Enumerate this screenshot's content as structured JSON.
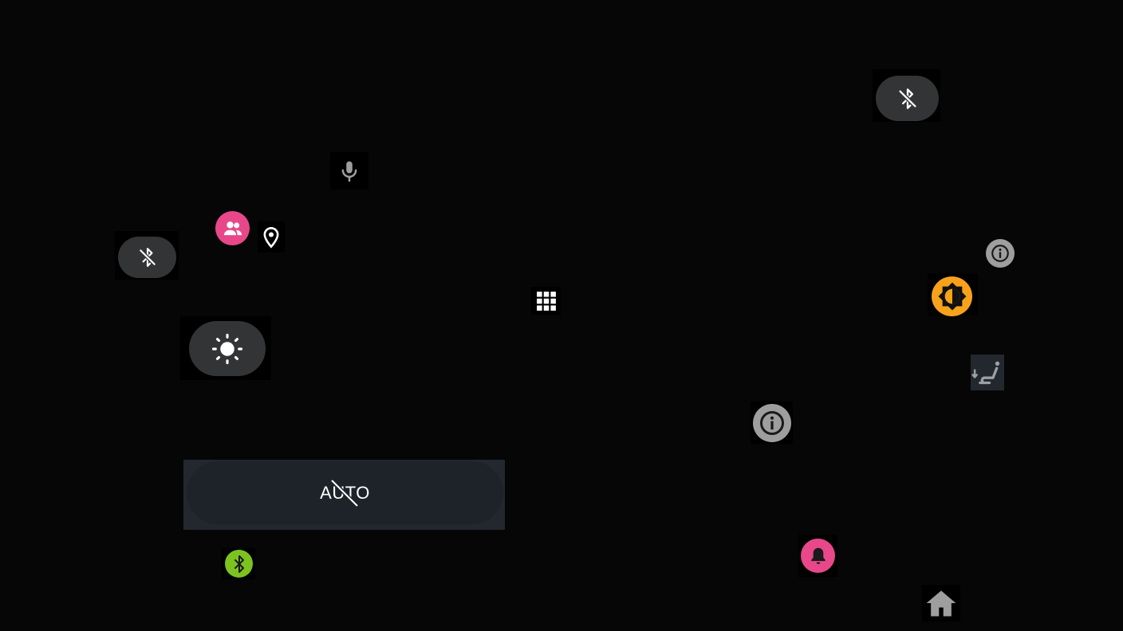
{
  "screen": {
    "background": "#060606",
    "tile_background": "#000000",
    "pill_background": "#323436",
    "auto_panel_background": "#22282e",
    "auto_pill_background": "#1d2329"
  },
  "controls": {
    "bluetooth_top": {
      "icon": "bluetooth-disabled-icon",
      "state": "off"
    },
    "bluetooth_left": {
      "icon": "bluetooth-disabled-icon",
      "state": "off"
    },
    "microphone": {
      "icon": "microphone-icon",
      "color": "#9e9e9e"
    },
    "account": {
      "icon": "people-icon",
      "color": "#e8488a"
    },
    "location": {
      "icon": "location-pin-icon",
      "color": "#ffffff"
    },
    "brightness": {
      "icon": "brightness-icon",
      "color": "#ffffff"
    },
    "apps_grid": {
      "icon": "app-grid-icon",
      "color": "#ffffff"
    },
    "info_small": {
      "icon": "info-icon",
      "color": "#9e9e9e"
    },
    "display_mode": {
      "icon": "contrast-icon",
      "color": "#f7a21b"
    },
    "seat": {
      "icon": "seat-recline-icon",
      "color": "#9aa0a6",
      "background": "#22282e"
    },
    "info_large": {
      "icon": "info-icon",
      "color": "#9e9e9e"
    },
    "auto_brightness": {
      "label": "AUTO",
      "state": "off"
    },
    "bluetooth_connected": {
      "icon": "bluetooth-icon",
      "color": "#7cc320"
    },
    "notifications": {
      "icon": "bell-icon",
      "color": "#e8488a"
    },
    "home": {
      "icon": "home-icon",
      "color": "#9e9e9e"
    }
  }
}
